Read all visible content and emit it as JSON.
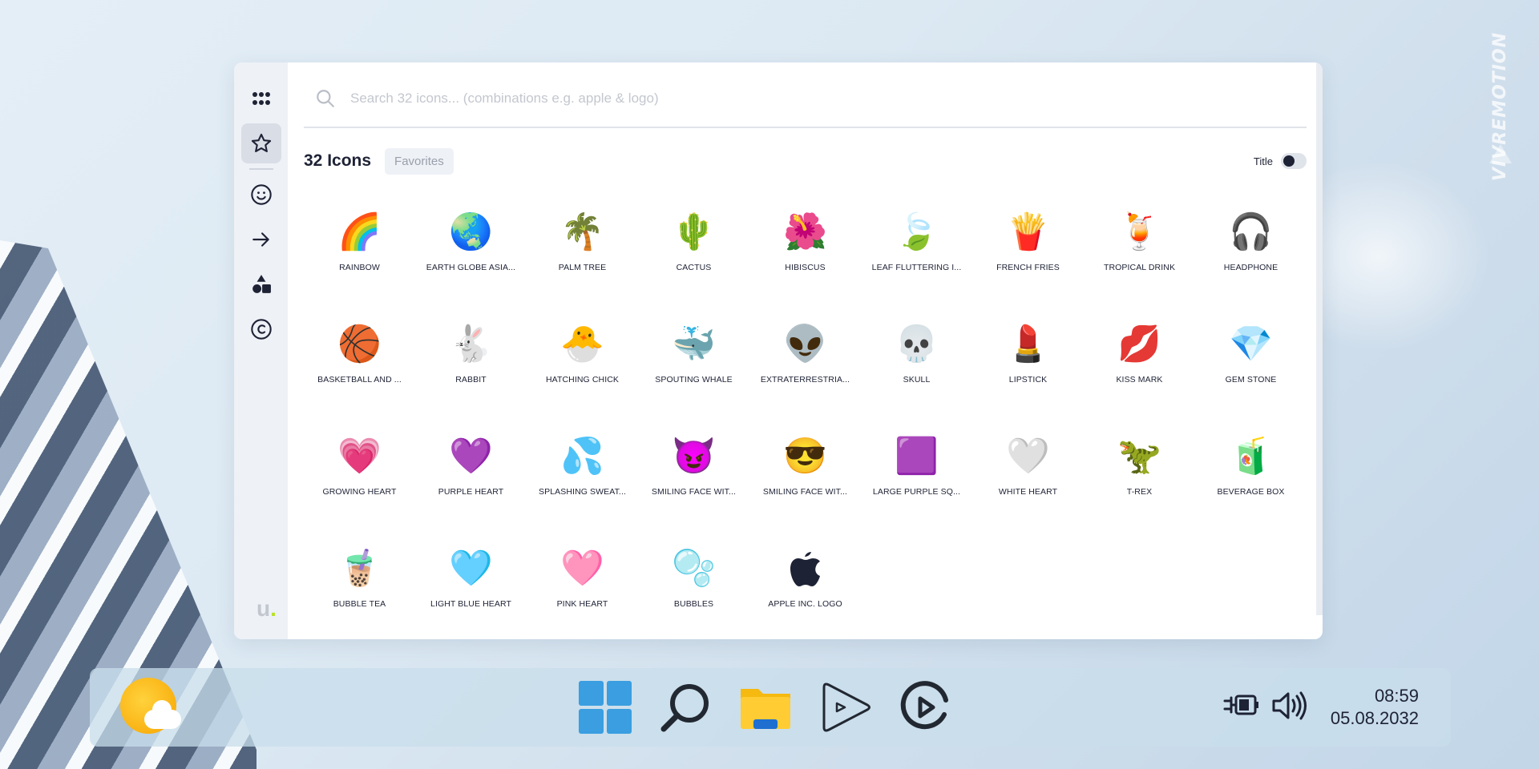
{
  "watermark": "VIVREMOTION",
  "sidebar": {
    "items": [
      {
        "name": "grid-icon"
      },
      {
        "name": "star-icon",
        "active": true
      },
      {
        "name": "smiley-icon"
      },
      {
        "name": "arrow-right-icon"
      },
      {
        "name": "shapes-icon"
      },
      {
        "name": "copyright-icon"
      }
    ],
    "logo_letter": "u",
    "logo_dot": "."
  },
  "search": {
    "placeholder": "Search 32 icons... (combinations e.g. apple & logo)"
  },
  "header": {
    "count_label": "32 Icons",
    "filter_tag": "Favorites",
    "title_toggle_label": "Title"
  },
  "icons": [
    {
      "glyph": "🌈",
      "label": "RAINBOW"
    },
    {
      "glyph": "🌏",
      "label": "EARTH GLOBE ASIA..."
    },
    {
      "glyph": "🌴",
      "label": "PALM TREE"
    },
    {
      "glyph": "🌵",
      "label": "CACTUS"
    },
    {
      "glyph": "🌺",
      "label": "HIBISCUS"
    },
    {
      "glyph": "🍃",
      "label": "LEAF FLUTTERING I..."
    },
    {
      "glyph": "🍟",
      "label": "FRENCH FRIES"
    },
    {
      "glyph": "🍹",
      "label": "TROPICAL DRINK"
    },
    {
      "glyph": "🎧",
      "label": "HEADPHONE"
    },
    {
      "glyph": "🏀",
      "label": "BASKETBALL AND ..."
    },
    {
      "glyph": "🐇",
      "label": "RABBIT"
    },
    {
      "glyph": "🐣",
      "label": "HATCHING CHICK"
    },
    {
      "glyph": "🐳",
      "label": "SPOUTING WHALE"
    },
    {
      "glyph": "👽",
      "label": "EXTRATERRESTRIA..."
    },
    {
      "glyph": "💀",
      "label": "SKULL"
    },
    {
      "glyph": "💄",
      "label": "LIPSTICK"
    },
    {
      "glyph": "💋",
      "label": "KISS MARK"
    },
    {
      "glyph": "💎",
      "label": "GEM STONE"
    },
    {
      "glyph": "💗",
      "label": "GROWING HEART"
    },
    {
      "glyph": "💜",
      "label": "PURPLE HEART"
    },
    {
      "glyph": "💦",
      "label": "SPLASHING SWEAT..."
    },
    {
      "glyph": "😈",
      "label": "SMILING FACE WIT..."
    },
    {
      "glyph": "😎",
      "label": "SMILING FACE WIT..."
    },
    {
      "glyph": "🟪",
      "label": "LARGE PURPLE SQ..."
    },
    {
      "glyph": "🤍",
      "label": "WHITE HEART"
    },
    {
      "glyph": "🦖",
      "label": "T-REX"
    },
    {
      "glyph": "🧃",
      "label": "BEVERAGE BOX"
    },
    {
      "glyph": "🧋",
      "label": "BUBBLE TEA"
    },
    {
      "glyph": "🩵",
      "label": "LIGHT BLUE HEART"
    },
    {
      "glyph": "🩷",
      "label": "PINK HEART"
    },
    {
      "glyph": "🫧",
      "label": "BUBBLES"
    },
    {
      "glyph": "",
      "label": "APPLE INC. LOGO"
    }
  ],
  "taskbar": {
    "apps": [
      {
        "name": "windows-start-icon"
      },
      {
        "name": "search-icon"
      },
      {
        "name": "file-explorer-icon"
      },
      {
        "name": "media-player-icon"
      },
      {
        "name": "elgato-icon"
      }
    ],
    "time": "08:59",
    "date": "05.08.2032"
  },
  "colors": {
    "accent_dark": "#1e2235",
    "sidebar_bg": "#eef1f6",
    "logo_dot": "#b9e12a"
  }
}
